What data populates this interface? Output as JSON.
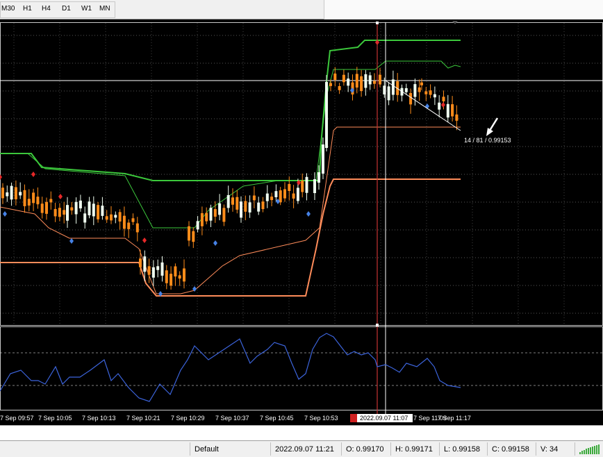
{
  "toolbar": {
    "timeframes": [
      "M30",
      "H1",
      "H4",
      "D1",
      "W1",
      "MN"
    ]
  },
  "chart": {
    "x_labels": [
      "7 Sep 09:57",
      "7 Sep 10:05",
      "7 Sep 10:13",
      "7 Sep 10:21",
      "7 Sep 10:29",
      "7 Sep 10:37",
      "7 Sep 10:45",
      "7 Sep 10:53",
      "7 Sep 11:09",
      "7 Sep 11:17"
    ],
    "crosshair_time_label": "2022.09.07 11:07",
    "measure_label": "14 / 81 / 0.99153",
    "colors": {
      "background": "#000000",
      "bull_candle": "#f0fff0",
      "bear_candle": "#ff8c1a",
      "upper_channel": "#3cc83c",
      "lower_channel": "#ff8c5a",
      "oscillator": "#3c64dc",
      "grid": "#ffffff",
      "crosshair_v_red": "#c83232"
    }
  },
  "status": {
    "profile": "Default",
    "datetime": "2022.09.07 11:21",
    "open": "O: 0.99170",
    "high": "H: 0.99171",
    "low": "L: 0.99158",
    "close": "C: 0.99158",
    "volume": "V: 34"
  }
}
